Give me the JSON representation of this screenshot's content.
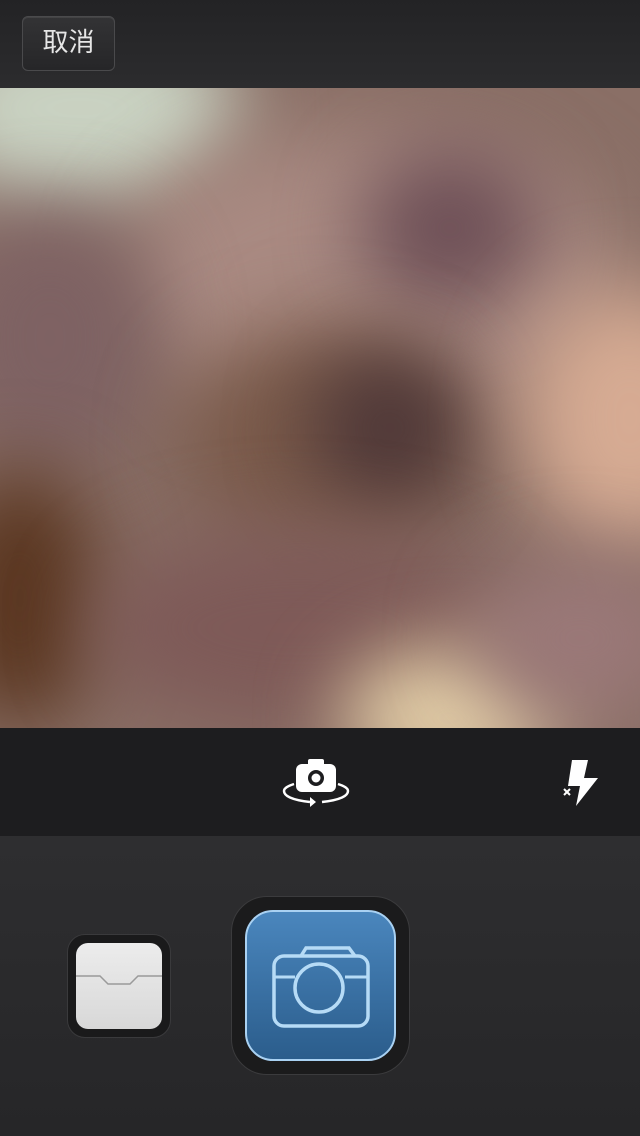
{
  "header": {
    "cancel_label": "取消"
  },
  "viewfinder": {
    "content": "blurred-camera-preview"
  },
  "controls": {
    "flip_icon": "switch-camera-icon",
    "flash_icon": "flash-off-icon"
  },
  "bottom": {
    "library_icon": "photo-library-icon",
    "shutter_icon": "camera-icon"
  },
  "colors": {
    "shutter_blue": "#3a74aa",
    "shutter_border": "#a9d1f2",
    "background": "#1f1f21"
  }
}
